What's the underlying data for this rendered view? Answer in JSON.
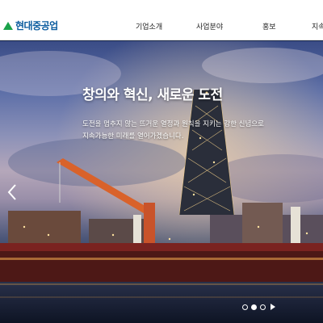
{
  "header": {
    "logo_text": "현대중공업",
    "nav": [
      {
        "label": "기업소개"
      },
      {
        "label": "사업분야"
      },
      {
        "label": "홍보"
      },
      {
        "label": "지속"
      }
    ]
  },
  "hero": {
    "title": "창의와 혁신, 새로운 도전",
    "description_lines": [
      "도전을 멈추지 않는 뜨거운 열정과 원칙을 지키는 강한 신념으로",
      "지속가능한 미래를 열어가겠습니다."
    ],
    "slider": {
      "slide_count": 3,
      "active_index": 1
    }
  },
  "colors": {
    "brand_blue": "#0a5b9e",
    "brand_green": "#1aa24a",
    "header_bg": "#ffffff",
    "nav_text": "#222222"
  },
  "icons": [
    "logo-triangle",
    "chevron-left-icon",
    "play-icon"
  ]
}
